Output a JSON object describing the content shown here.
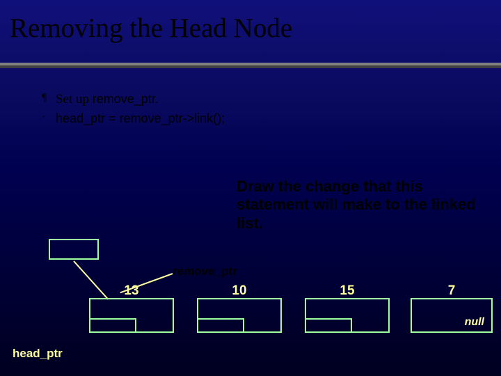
{
  "title": "Removing the Head Node",
  "bullets": {
    "b1_mark": "¶",
    "b1_prefix": "Set up ",
    "b1_code": "remove_ptr.",
    "b2_mark": "·",
    "b2_code": "head_ptr  =  remove_ptr->link();"
  },
  "callout": "Draw the change that this statement will make to the linked list.",
  "labels": {
    "remove_ptr": "remove_ptr",
    "head_ptr": "head_ptr"
  },
  "nodes": {
    "n1": "13",
    "n2": "10",
    "n3": "15",
    "n4": "7",
    "null_text": "null"
  }
}
